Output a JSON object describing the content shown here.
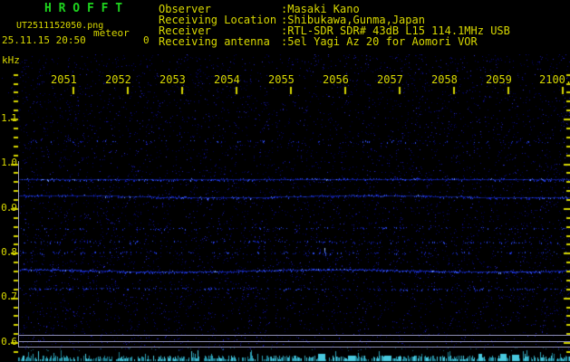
{
  "app": {
    "title": "H R O F F T",
    "filename": "UT2511152050.png",
    "mode": "meteor",
    "datetime": "25.11.15 20:50",
    "echo_count": "0"
  },
  "header_fields": [
    {
      "label": "Observer",
      "value": ":Masaki Kano"
    },
    {
      "label": "Receiving Location",
      "value": ":Shibukawa,Gunma,Japan"
    },
    {
      "label": "Receiver",
      "value": ":RTL-SDR SDR# 43dB L15 114.1MHz USB"
    },
    {
      "label": "Receiving antenna",
      "value": ":5el Yagi Az 20 for Aomori VOR"
    }
  ],
  "axes": {
    "freq_unit": "kHz",
    "freq_labels": [
      "1.1",
      "1.0",
      "0.9",
      "0.8",
      "0.7",
      "0.6"
    ],
    "freq_range_khz": [
      0.6,
      1.2
    ],
    "time_labels": [
      "2051",
      "2052",
      "2053",
      "2054",
      "2055",
      "2056",
      "2057",
      "2058",
      "2059",
      "2100."
    ]
  },
  "colors": {
    "background": "#000000",
    "title_green": "#1ed41e",
    "text_yellow": "#d8d800",
    "grid_gray": "#9494b8",
    "signal_blue": "#2846e6",
    "level_cyan": "#46c8dc"
  },
  "spectrogram": {
    "carrier_lines": [
      {
        "freq_khz": 1.05,
        "strength": 0.1,
        "wavy": false
      },
      {
        "freq_khz": 0.965,
        "strength": 0.6,
        "wavy": false
      },
      {
        "freq_khz": 0.925,
        "strength": 0.55,
        "wavy": true
      },
      {
        "freq_khz": 0.855,
        "strength": 0.18,
        "wavy": false
      },
      {
        "freq_khz": 0.825,
        "strength": 0.15,
        "wavy": false
      },
      {
        "freq_khz": 0.8,
        "strength": 0.15,
        "wavy": false
      },
      {
        "freq_khz": 0.76,
        "strength": 0.85,
        "wavy": true
      },
      {
        "freq_khz": 0.72,
        "strength": 0.35,
        "wavy": false
      }
    ],
    "meteor_echo": {
      "freq_khz": 0.805,
      "minutes_after_2050": 5.63
    }
  }
}
